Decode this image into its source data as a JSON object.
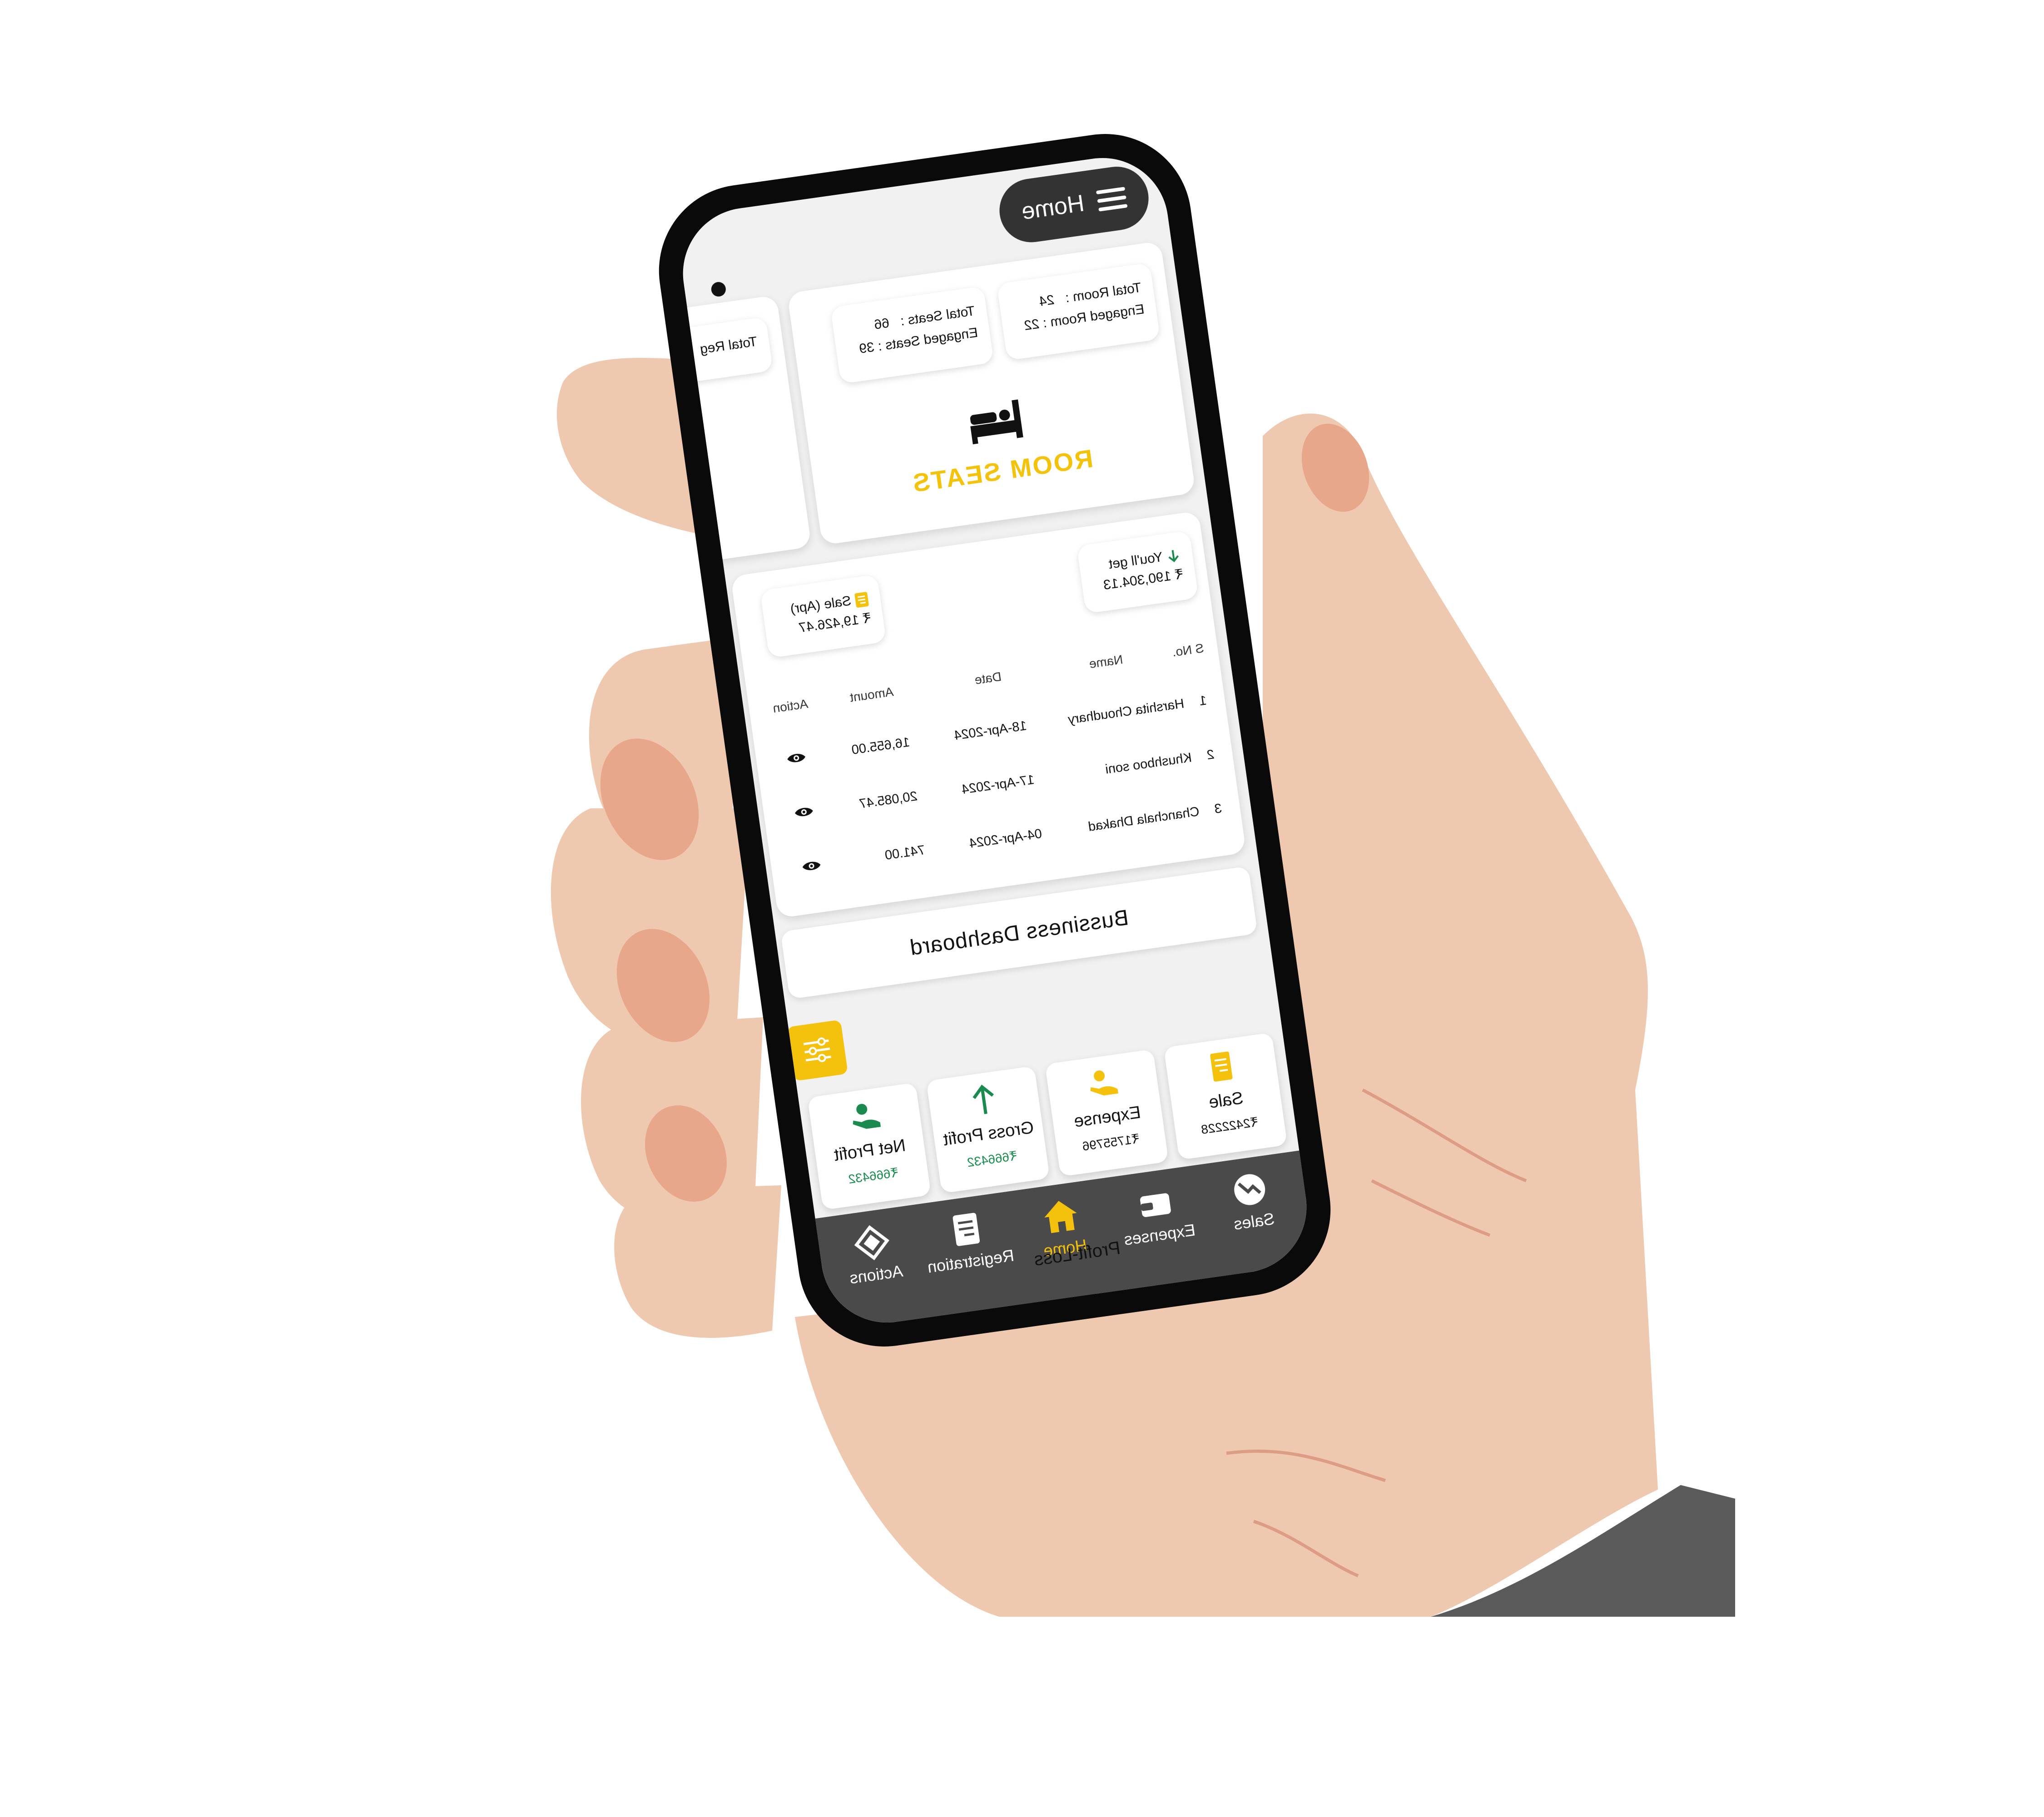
{
  "header": {
    "title": "Home"
  },
  "room_card": {
    "title": "ROOM SEATS",
    "total_room_label": "Total Room :",
    "total_room_value": "24",
    "engaged_room_label": "Engaged Room :",
    "engaged_room_value": "22",
    "total_seats_label": "Total Seats :",
    "total_seats_value": "66",
    "engaged_seats_label": "Engaged Seats :",
    "engaged_seats_value": "39"
  },
  "side_card": {
    "label": "Total Reg"
  },
  "summary": {
    "you_get_label": "You'll get",
    "you_get_value": "₹ 190,304.13",
    "sale_label": "Sale (Apr)",
    "sale_value": "₹ 19,426.47"
  },
  "table": {
    "headers": [
      "S No.",
      "Name",
      "Date",
      "Amount",
      "Action"
    ],
    "rows": [
      {
        "sno": "1",
        "name": "Harshita Choudhary",
        "date": "18-Apr-2024",
        "amount": "16,655.00"
      },
      {
        "sno": "2",
        "name": "Khushboo soni",
        "date": "17-Apr-2024",
        "amount": "20,085.47"
      },
      {
        "sno": "3",
        "name": "Chanchala  Dhakad",
        "date": "04-Apr-2024",
        "amount": "741.00"
      }
    ]
  },
  "dashboard_button": "Bussiness Dashboard",
  "tiles": [
    {
      "label": "Sale",
      "value": "₹2422228",
      "icon": "receipt-icon"
    },
    {
      "label": "Expense",
      "value": "₹1755796",
      "icon": "hand-coin-icon"
    },
    {
      "label": "Gross Profit",
      "value": "₹666432",
      "icon": "arrow-up-icon"
    },
    {
      "label": "Net Profit",
      "value": "₹666432",
      "icon": "hand-money-icon"
    }
  ],
  "nav": {
    "items": [
      {
        "label": "Sales",
        "icon": "trend-icon"
      },
      {
        "label": "Expenses",
        "icon": "wallet-icon"
      },
      {
        "label": "Home",
        "icon": "home-icon"
      },
      {
        "label": "Registration",
        "icon": "document-icon"
      },
      {
        "label": "Actions",
        "icon": "actions-icon"
      }
    ],
    "overlay_text": "Profit-Loss"
  },
  "colors": {
    "accent": "#f4c20d",
    "green": "#1b8a4f",
    "nav_bg": "#4a4a4a",
    "skin": "#efc8b0",
    "sleeve": "#5a5a5a"
  }
}
